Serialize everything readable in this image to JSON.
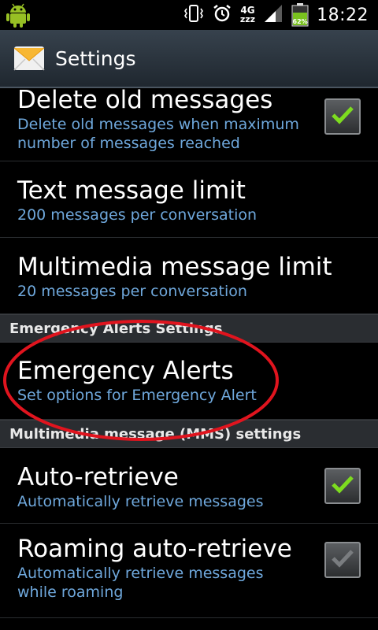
{
  "status_bar": {
    "network": "4G",
    "network_sub": "zzz",
    "battery_percent": "62%",
    "time": "18:22"
  },
  "action_bar": {
    "title": "Settings"
  },
  "preferences": {
    "delete_old": {
      "title": "Delete old messages",
      "summary": "Delete old messages when maximum number of messages reached",
      "checked": true
    },
    "text_limit": {
      "title": "Text message limit",
      "summary": "200 messages per conversation"
    },
    "mms_limit": {
      "title": "Multimedia message limit",
      "summary": "20 messages per conversation"
    },
    "emergency_category": "Emergency Alerts Settings",
    "emergency_alerts": {
      "title": "Emergency Alerts",
      "summary": "Set options for Emergency Alert"
    },
    "mms_category": "Multimedia message (MMS) settings",
    "auto_retrieve": {
      "title": "Auto-retrieve",
      "summary": "Automatically retrieve messages",
      "checked": true
    },
    "roaming_auto_retrieve": {
      "title": "Roaming auto-retrieve",
      "summary": "Automatically retrieve messages while roaming",
      "checked": true,
      "enabled": false
    }
  },
  "colors": {
    "summary_text": "#6fa8dc",
    "check_green": "#7ddc1f",
    "check_disabled": "#7a7d80",
    "highlight_circle": "#e0141e"
  },
  "icons": [
    "android-debug-icon",
    "vibrate-icon",
    "alarm-icon",
    "signal-icon",
    "battery-icon",
    "messages-icon",
    "checkmark-icon"
  ]
}
